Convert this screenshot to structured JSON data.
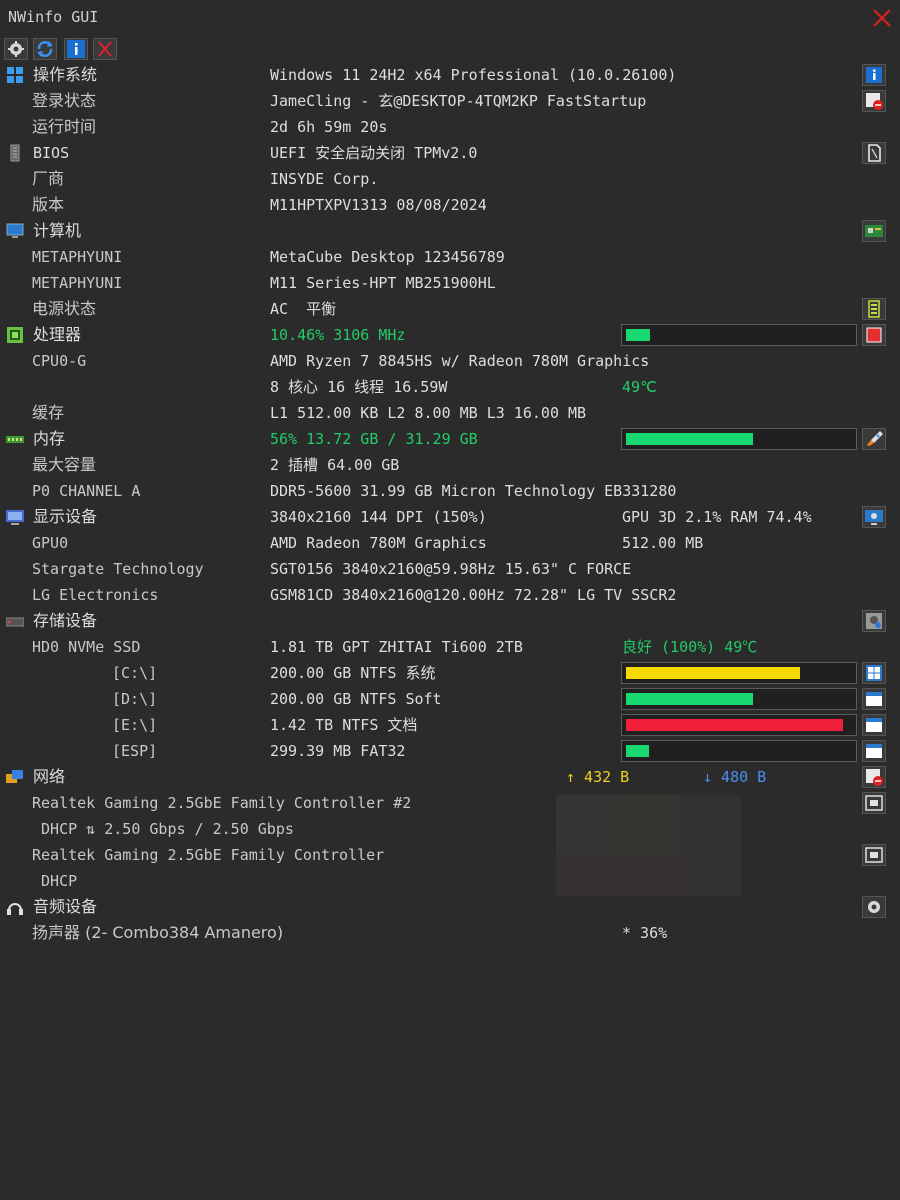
{
  "window": {
    "title": "NWinfo GUI"
  },
  "rows": {
    "os": {
      "label": "操作系统",
      "value": "Windows 11 24H2 x64 Professional (10.0.26100)"
    },
    "login": {
      "label": "登录状态",
      "value": "JameCling - 玄@DESKTOP-4TQM2KP FastStartup"
    },
    "uptime": {
      "label": "运行时间",
      "value": "2d 6h 59m 20s"
    },
    "bios": {
      "label": "BIOS",
      "value": "UEFI 安全启动关闭 TPMv2.0"
    },
    "vendor": {
      "label": "厂商",
      "value": "INSYDE Corp."
    },
    "version": {
      "label": "版本",
      "value": "M11HPTXPV1313 08/08/2024"
    },
    "computer": {
      "label": "计算机"
    },
    "meta1": {
      "label": "METAPHYUNI",
      "value": "MetaCube Desktop 123456789"
    },
    "meta2": {
      "label": "METAPHYUNI",
      "value": "M11 Series-HPT MB251900HL"
    },
    "power": {
      "label": "电源状态",
      "value": "AC  平衡"
    },
    "cpu": {
      "label": "处理器",
      "value": "10.46% 3106 MHz",
      "usage_percent": 10.46
    },
    "cpu0": {
      "label": "CPU0-G",
      "value": "AMD Ryzen 7 8845HS w/ Radeon 780M Graphics"
    },
    "cores": {
      "value": "8 核心 16 线程 16.59W",
      "temp": "49℃"
    },
    "cache": {
      "label": "缓存",
      "value": "L1 512.00 KB L2 8.00 MB L3 16.00 MB"
    },
    "memory": {
      "label": "内存",
      "value": "56% 13.72 GB / 31.29 GB",
      "usage_percent": 56
    },
    "maxcap": {
      "label": "最大容量",
      "value": "2 插槽 64.00 GB"
    },
    "channel": {
      "label": "P0 CHANNEL A",
      "value": "DDR5-5600 31.99 GB Micron Technology EB331280"
    },
    "display": {
      "label": "显示设备",
      "value": "3840x2160 144 DPI (150%)",
      "value2": "GPU 3D 2.1% RAM 74.4%"
    },
    "gpu0": {
      "label": "GPU0",
      "value": "AMD Radeon 780M Graphics",
      "value2": "512.00 MB"
    },
    "mon1": {
      "label": "Stargate Technology",
      "value": "SGT0156 3840x2160@59.98Hz 15.63\" C FORCE"
    },
    "mon2": {
      "label": "LG Electronics",
      "value": "GSM81CD 3840x2160@120.00Hz 72.28\" LG TV SSCR2"
    },
    "storage": {
      "label": "存储设备"
    },
    "hd0": {
      "label": "HD0 NVMe SSD",
      "value": "1.81 TB GPT ZHITAI Ti600 2TB",
      "value2": "良好 (100%) 49℃"
    },
    "driveC": {
      "label": "[C:\\]",
      "value": "200.00 GB NTFS 系统",
      "usage_percent": 77
    },
    "driveD": {
      "label": "[D:\\]",
      "value": "200.00 GB NTFS Soft",
      "usage_percent": 56
    },
    "driveE": {
      "label": "[E:\\]",
      "value": "1.42 TB NTFS 文档",
      "usage_percent": 96
    },
    "driveESP": {
      "label": "[ESP]",
      "value": "299.39 MB FAT32",
      "usage_percent": 10
    },
    "network": {
      "label": "网络",
      "up": "↑ 432 B",
      "down": "↓ 480 B"
    },
    "nic1": {
      "label": "Realtek Gaming 2.5GbE Family Controller #2"
    },
    "nic1sub": {
      "label": " DHCP ⇅ 2.50 Gbps / 2.50 Gbps"
    },
    "nic2": {
      "label": "Realtek Gaming 2.5GbE Family Controller"
    },
    "nic2sub": {
      "label": " DHCP"
    },
    "audio": {
      "label": "音频设备"
    },
    "speaker": {
      "label": "扬声器 (2- Combo384 Amanero)",
      "value2": "* 36%"
    }
  },
  "colors": {
    "bar_green": "#18d870",
    "bar_yellow": "#f5d800",
    "bar_red": "#f0203a",
    "text_green": "#22cc66"
  }
}
